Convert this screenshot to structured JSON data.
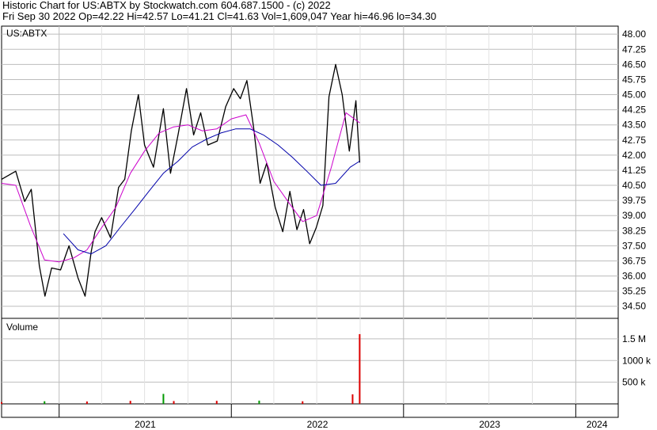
{
  "header": {
    "line1": "Historic Chart for US:ABTX by Stockwatch.com 604.687.1500 - (c) 2022",
    "line2": "Fri Sep 30 2022   Op=42.22   Hi=42.57   Lo=41.21   Cl=41.63   Vol=1,609,047   Year hi=46.96   lo=34.30"
  },
  "colors": {
    "price": "#000000",
    "ma_short": "#cc00cc",
    "ma_long": "#0000aa",
    "volume_down": "#dd0000",
    "volume_up": "#009900",
    "grid": "#bdbdbd"
  },
  "chart_data": [
    {
      "type": "line",
      "symbol_label": "US:ABTX",
      "ylim": [
        33.9,
        48.4
      ],
      "y_ticks": [
        "48.00",
        "47.25",
        "46.50",
        "45.75",
        "45.00",
        "44.25",
        "43.50",
        "42.75",
        "42.00",
        "41.25",
        "40.50",
        "39.75",
        "39.00",
        "38.25",
        "37.50",
        "36.75",
        "36.00",
        "35.25",
        "34.50"
      ],
      "x_labels": [
        "2021",
        "2022",
        "2023",
        "2024"
      ],
      "x_range": [
        "2020-09-01",
        "2024-03-31"
      ],
      "series": [
        {
          "role": "price",
          "x": [
            "2020-09-01",
            "2020-10-01",
            "2020-10-20",
            "2020-11-03",
            "2020-11-20",
            "2020-12-02",
            "2020-12-16",
            "2021-01-04",
            "2021-01-22",
            "2021-02-10",
            "2021-02-25",
            "2021-03-10",
            "2021-03-18",
            "2021-04-01",
            "2021-04-20",
            "2021-05-07",
            "2021-05-20",
            "2021-06-03",
            "2021-06-18",
            "2021-07-01",
            "2021-07-20",
            "2021-08-10",
            "2021-08-25",
            "2021-09-10",
            "2021-09-28",
            "2021-10-13",
            "2021-10-28",
            "2021-11-12",
            "2021-12-02",
            "2021-12-20",
            "2022-01-06",
            "2022-01-20",
            "2022-02-03",
            "2022-02-17",
            "2022-03-03",
            "2022-03-17",
            "2022-04-04",
            "2022-04-20",
            "2022-05-05",
            "2022-05-20",
            "2022-06-03",
            "2022-06-16",
            "2022-06-30",
            "2022-07-14",
            "2022-07-27",
            "2022-08-10",
            "2022-08-24",
            "2022-09-08",
            "2022-09-22",
            "2022-09-30"
          ],
          "values": [
            40.8,
            41.2,
            39.7,
            40.3,
            36.5,
            35.0,
            36.4,
            36.3,
            37.5,
            35.9,
            35.0,
            37.2,
            38.2,
            38.9,
            37.9,
            40.4,
            40.8,
            43.2,
            45.0,
            42.5,
            41.4,
            44.3,
            41.1,
            43.0,
            45.3,
            43.0,
            44.1,
            42.5,
            42.7,
            44.4,
            45.3,
            44.8,
            45.7,
            43.4,
            40.6,
            41.6,
            39.4,
            38.2,
            40.2,
            38.3,
            39.3,
            37.6,
            38.4,
            39.5,
            44.9,
            46.5,
            45.0,
            42.2,
            44.7,
            41.63
          ]
        },
        {
          "role": "moving_average_short",
          "x": [
            "2020-09-01",
            "2020-10-01",
            "2020-11-01",
            "2020-12-01",
            "2021-01-01",
            "2021-02-01",
            "2021-03-01",
            "2021-04-01",
            "2021-05-01",
            "2021-06-01",
            "2021-07-01",
            "2021-08-01",
            "2021-09-01",
            "2021-10-01",
            "2021-11-01",
            "2021-12-01",
            "2022-01-01",
            "2022-02-01",
            "2022-03-01",
            "2022-04-01",
            "2022-05-01",
            "2022-06-01",
            "2022-07-01",
            "2022-08-01",
            "2022-09-01",
            "2022-09-30"
          ],
          "values": [
            40.6,
            40.5,
            38.5,
            36.8,
            36.7,
            36.9,
            37.3,
            38.4,
            39.4,
            41.1,
            42.2,
            43.1,
            43.4,
            43.5,
            43.2,
            43.3,
            43.8,
            44.0,
            42.6,
            40.7,
            39.7,
            38.7,
            39.0,
            41.4,
            44.1,
            43.6
          ]
        },
        {
          "role": "moving_average_long",
          "x": [
            "2021-01-10",
            "2021-02-10",
            "2021-03-10",
            "2021-04-10",
            "2021-05-10",
            "2021-06-10",
            "2021-07-10",
            "2021-08-10",
            "2021-09-10",
            "2021-10-10",
            "2021-11-10",
            "2021-12-10",
            "2022-01-10",
            "2022-02-10",
            "2022-03-10",
            "2022-04-10",
            "2022-05-10",
            "2022-06-10",
            "2022-07-10",
            "2022-08-10",
            "2022-09-10",
            "2022-09-30"
          ],
          "values": [
            38.1,
            37.3,
            37.1,
            37.5,
            38.4,
            39.3,
            40.2,
            41.1,
            41.7,
            42.4,
            42.8,
            43.1,
            43.3,
            43.3,
            43.0,
            42.5,
            41.9,
            41.2,
            40.5,
            40.6,
            41.4,
            41.7
          ]
        }
      ]
    },
    {
      "type": "bar",
      "title": "Volume",
      "ylim": [
        0,
        1900000
      ],
      "y_ticks": [
        "1.5 M",
        "1000 k",
        "500 k"
      ],
      "y_tick_values": [
        1500000,
        1000000,
        500000
      ],
      "x": [
        "2020-09-01",
        "2020-12-01",
        "2021-03-01",
        "2021-06-01",
        "2021-08-10",
        "2021-09-01",
        "2021-12-01",
        "2022-03-01",
        "2022-06-01",
        "2022-09-15",
        "2022-09-30"
      ],
      "values": [
        40000,
        60000,
        55000,
        70000,
        230000,
        65000,
        70000,
        75000,
        60000,
        220000,
        1609047
      ]
    }
  ]
}
